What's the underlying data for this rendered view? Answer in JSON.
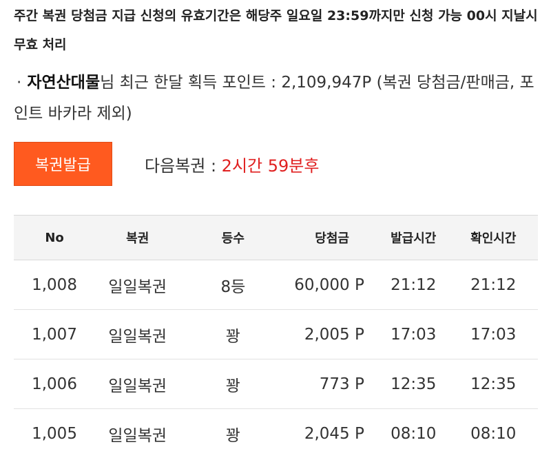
{
  "notice": {
    "text": "주간 복권 당첨금 지급 신청의 유효기간은 해당주 일요일 23:59까지만 신청 가능 00시 지날시 무효 처리"
  },
  "points_info": {
    "bullet": "·",
    "nickname": "자연산대물",
    "suffix": "님 최근 한달 획득 포인트 : 2,109,947P (복권 당첨금/판매금, 포인트 바카라 제외)"
  },
  "issue": {
    "button_label": "복권발급",
    "next_label": "다음복권 : ",
    "countdown": "2시간 59분후"
  },
  "table": {
    "headers": {
      "no": "No",
      "ticket": "복권",
      "rank": "등수",
      "prize": "당첨금",
      "issued": "발급시간",
      "checked": "확인시간"
    },
    "rows": [
      {
        "no": "1,008",
        "ticket": "일일복권",
        "rank": "8등",
        "prize": "60,000 P",
        "issued": "21:12",
        "checked": "21:12"
      },
      {
        "no": "1,007",
        "ticket": "일일복권",
        "rank": "꽝",
        "prize": "2,005 P",
        "issued": "17:03",
        "checked": "17:03"
      },
      {
        "no": "1,006",
        "ticket": "일일복권",
        "rank": "꽝",
        "prize": "773 P",
        "issued": "12:35",
        "checked": "12:35"
      },
      {
        "no": "1,005",
        "ticket": "일일복권",
        "rank": "꽝",
        "prize": "2,045 P",
        "issued": "08:10",
        "checked": "08:10"
      }
    ]
  },
  "colors": {
    "accent": "#ff5a1f",
    "countdown": "#e02020"
  }
}
